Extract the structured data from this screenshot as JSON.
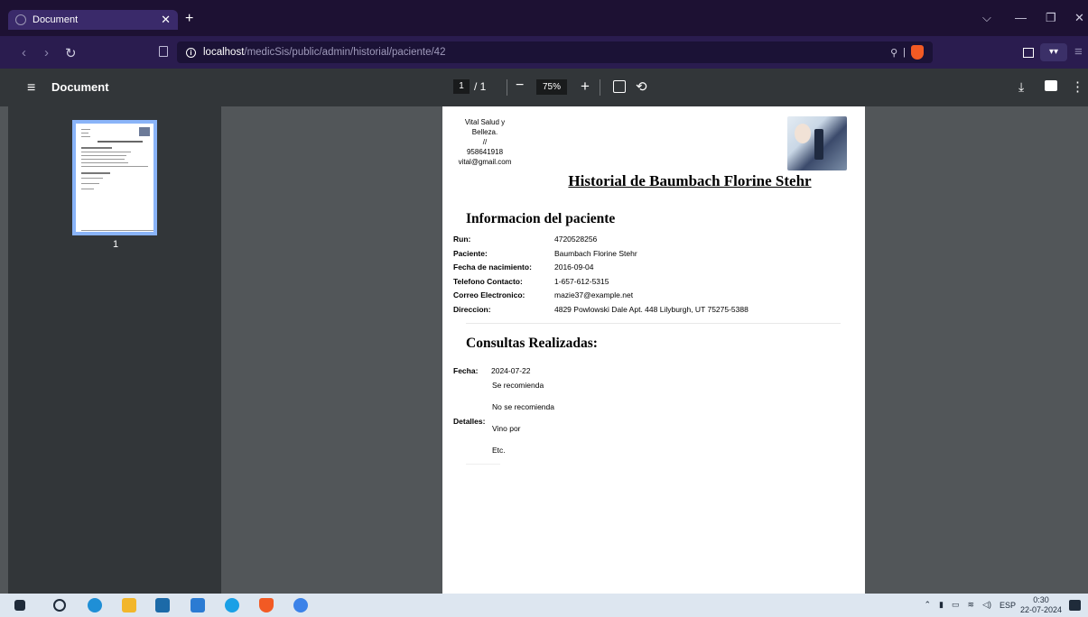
{
  "browser": {
    "tab_title": "Document",
    "new_tab": "+",
    "url_host": "localhost",
    "url_path": "/medicSis/public/admin/historial/paciente/42"
  },
  "pdf_toolbar": {
    "title": "Document",
    "current_page": "1",
    "page_total": "/ 1",
    "zoom": "75%"
  },
  "thumbnails": [
    {
      "page_number": "1"
    }
  ],
  "document": {
    "clinic_lines": [
      "Vital Salud y",
      "Belleza.",
      "//",
      "958641918",
      "vital@gmail.com"
    ],
    "title": "Historial de Baumbach Florine Stehr",
    "patient_section": {
      "heading": "Informacion del paciente",
      "fields": [
        {
          "label": "Run:",
          "value": "4720528256"
        },
        {
          "label": "Paciente:",
          "value": "Baumbach Florine Stehr"
        },
        {
          "label": "Fecha de nacimiento:",
          "value": "2016-09-04"
        },
        {
          "label": "Telefono Contacto:",
          "value": "1-657-612-5315"
        },
        {
          "label": "Correo Electronico:",
          "value": "mazie37@example.net"
        },
        {
          "label": "Direccion:",
          "value": "4829 Powlowski Dale Apt. 448 Lilyburgh, UT 75275-5388"
        }
      ]
    },
    "consultas_section": {
      "heading": "Consultas Realizadas:",
      "fecha_label": "Fecha:",
      "fecha_value": "2024-07-22",
      "recommendation_lines": [
        "Se recomienda",
        "No se recomienda"
      ],
      "detalles_label": "Detalles:",
      "detalles_lines": [
        "Vino por",
        "Etc."
      ]
    }
  },
  "taskbar": {
    "language": "ESP",
    "time": "0:30",
    "date": "22-07-2024"
  }
}
